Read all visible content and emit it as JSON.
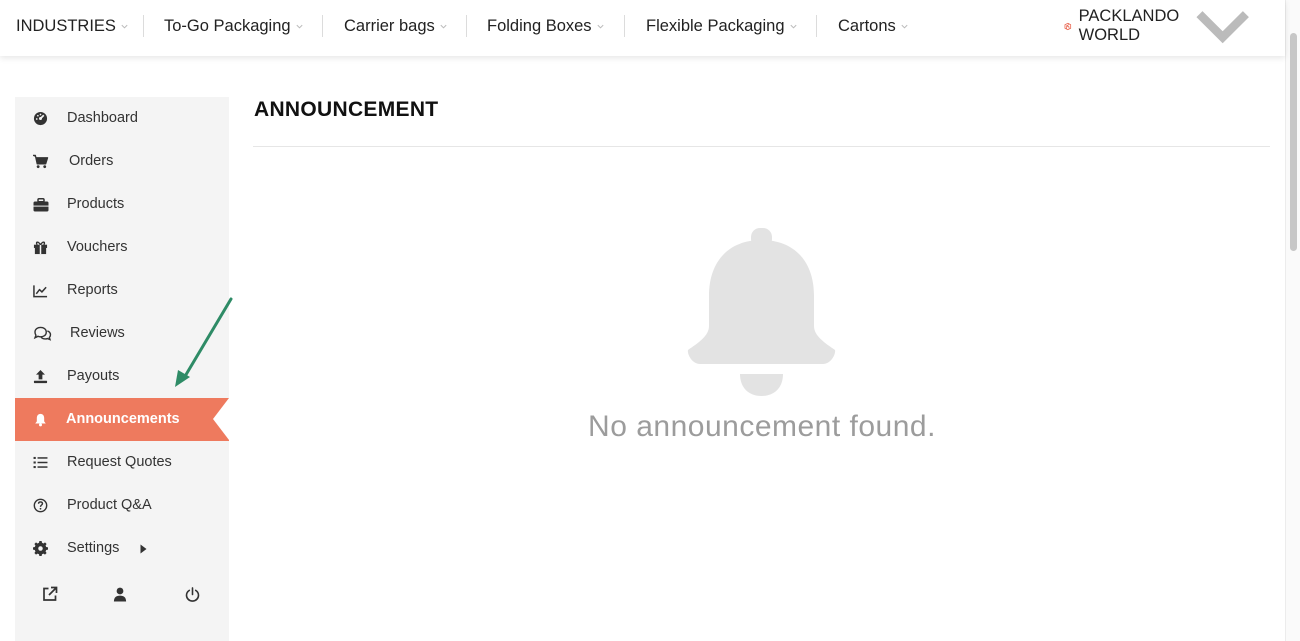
{
  "topnav": {
    "items": [
      {
        "label": "INDUSTRIES"
      },
      {
        "label": "To-Go Packaging"
      },
      {
        "label": "Carrier bags"
      },
      {
        "label": "Folding Boxes"
      },
      {
        "label": "Flexible Packaging"
      },
      {
        "label": "Cartons"
      }
    ],
    "brand": {
      "label": "PACKLANDO WORLD",
      "logo_icon": "packlando-logo"
    },
    "brand_color": "#e8604a"
  },
  "sidebar": {
    "items": [
      {
        "label": "Dashboard",
        "icon": "dashboard-icon"
      },
      {
        "label": "Orders",
        "icon": "cart-icon"
      },
      {
        "label": "Products",
        "icon": "briefcase-icon"
      },
      {
        "label": "Vouchers",
        "icon": "gift-icon"
      },
      {
        "label": "Reports",
        "icon": "chart-line-icon"
      },
      {
        "label": "Reviews",
        "icon": "comments-icon"
      },
      {
        "label": "Payouts",
        "icon": "upload-icon"
      },
      {
        "label": "Announcements",
        "icon": "bell-icon",
        "active": true
      },
      {
        "label": "Request Quotes",
        "icon": "list-icon"
      },
      {
        "label": "Product Q&A",
        "icon": "question-circle-icon"
      },
      {
        "label": "Settings",
        "icon": "gear-icon",
        "has_submenu": true
      }
    ],
    "bottom_icons": [
      "external-link-icon",
      "user-icon",
      "power-icon"
    ],
    "active_color": "#ee7a5e"
  },
  "main": {
    "title": "ANNOUNCEMENT",
    "empty_message": "No announcement found.",
    "empty_icon": "bell-icon"
  },
  "annotation": {
    "arrow_color": "#2e8b66"
  }
}
